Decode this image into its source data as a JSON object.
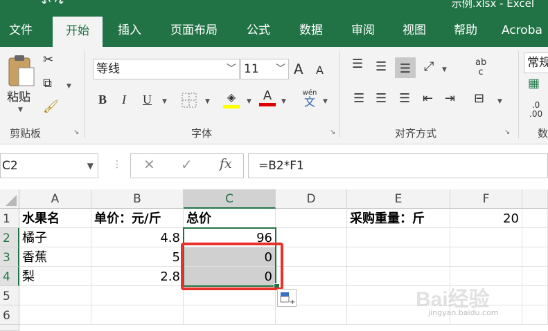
{
  "window": {
    "title": "示例.xlsx - Excel"
  },
  "tabs": [
    "文件",
    "开始",
    "插入",
    "页面布局",
    "公式",
    "数据",
    "审阅",
    "视图",
    "帮助",
    "Acroba"
  ],
  "active_tab": "开始",
  "ribbon": {
    "clipboard": {
      "paste_label": "粘贴",
      "group_label": "剪贴板"
    },
    "font": {
      "font_name": "等线",
      "font_size": "11",
      "group_label": "字体",
      "phonetic_label": "wén",
      "phonetic_char": "文",
      "bold": "B",
      "italic": "I",
      "underline": "U",
      "grow": "A",
      "shrink": "A",
      "font_color_letter": "A",
      "highlight_color": "#ffff00",
      "font_color": "#e00000"
    },
    "alignment": {
      "group_label": "对齐方式",
      "wrap_label": "ab",
      "wrap_sub": "c"
    },
    "number": {
      "format": "常规",
      "dec_label": ".0",
      "dec_label2": ".00",
      "group_label_partial": "数"
    }
  },
  "formula_bar": {
    "name_box": "C2",
    "cancel": "✕",
    "enter": "✓",
    "fx": "fx",
    "formula": "=B2*F1"
  },
  "grid": {
    "columns": [
      "A",
      "B",
      "C",
      "D",
      "E",
      "F"
    ],
    "rows": [
      "1",
      "2",
      "3",
      "4",
      "5",
      "6"
    ],
    "cells": {
      "A1": "水果名",
      "B1": "单价：元/斤",
      "C1": "总价",
      "E1": "采购重量：斤",
      "F1": "20",
      "A2": "橘子",
      "B2": "4.8",
      "C2": "96",
      "A3": "香蕉",
      "B3": "5",
      "C3": "0",
      "A4": "梨",
      "B4": "2.8",
      "C4": "0"
    }
  },
  "watermark": {
    "brand": "Bai经验",
    "url": "jingyan.baidu.com"
  }
}
